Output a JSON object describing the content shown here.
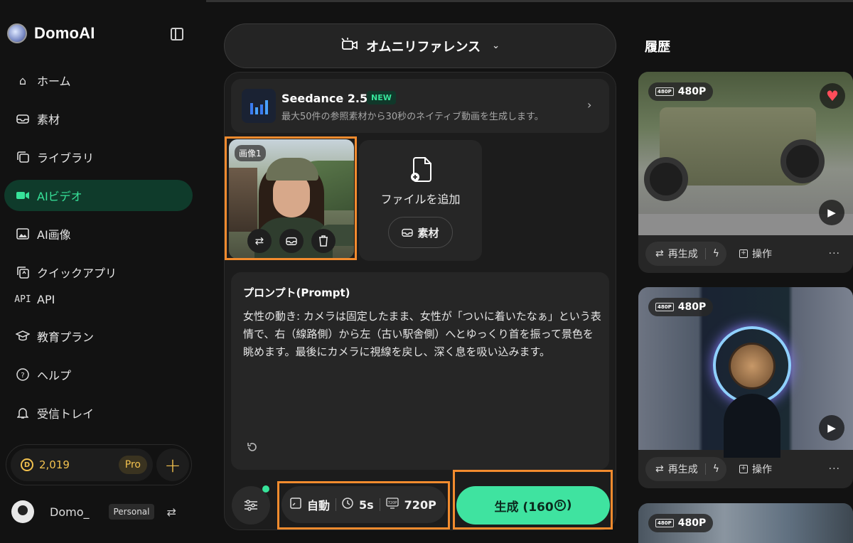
{
  "app": {
    "name": "DomoAI"
  },
  "sidebar": {
    "items": [
      {
        "label": "ホーム",
        "icon": "home-icon",
        "glyph": "⌂"
      },
      {
        "label": "素材",
        "icon": "inbox-icon",
        "glyph": "▭"
      },
      {
        "label": "ライブラリ",
        "icon": "library-icon",
        "glyph": "❐"
      },
      {
        "label": "AIビデオ",
        "icon": "video-camera-icon",
        "glyph": "■"
      },
      {
        "label": "AI画像",
        "icon": "image-icon",
        "glyph": "▣"
      },
      {
        "label": "クイックアプリ",
        "icon": "quick-app-icon",
        "glyph": "⧉"
      },
      {
        "label": "API",
        "icon": "api-icon",
        "glyph": "API"
      },
      {
        "label": "教育プラン",
        "icon": "graduation-cap-icon",
        "glyph": "⌂"
      },
      {
        "label": "ヘルプ",
        "icon": "help-icon",
        "glyph": "?"
      },
      {
        "label": "受信トレイ",
        "icon": "bell-icon",
        "glyph": "♫"
      }
    ],
    "active_index": 3,
    "credits": {
      "amount": "2,019",
      "plan": "Pro",
      "coin_symbol": "D"
    },
    "user": {
      "name": "Domo_",
      "plan_badge": "Personal"
    }
  },
  "main": {
    "mode_label": "オムニリファレンス",
    "model": {
      "name": "Seedance 2.5",
      "badge": "NEW",
      "description": "最大50件の参照素材から30秒のネイティブ動画を生成します。"
    },
    "reference_image": {
      "label": "画像1"
    },
    "add_file": {
      "label": "ファイルを追加",
      "material_button": "素材"
    },
    "prompt": {
      "title": "プロンプト(Prompt)",
      "text": "女性の動き: カメラは固定したまま、女性が「ついに着いたなぁ」という表情で、右（線路側）から左（古い駅舎側）へとゆっくり首を振って景色を眺めます。最後にカメラに視線を戻し、深く息を吸い込みます。"
    },
    "options": {
      "aspect": "自動",
      "duration": "5s",
      "resolution": "720P",
      "resolution_icon_text": "720P"
    },
    "generate_button": "生成 (160",
    "generate_suffix": ")"
  },
  "history": {
    "title": "履歴",
    "items": [
      {
        "resolution": "480P",
        "regen_label": "再生成",
        "op_label": "操作",
        "favorited": true
      },
      {
        "resolution": "480P",
        "regen_label": "再生成",
        "op_label": "操作",
        "favorited": false
      },
      {
        "resolution": "480P"
      }
    ]
  },
  "colors": {
    "accent_green": "#3fe3a0",
    "highlight_orange": "#f28b2e",
    "coin_gold": "#f2c14e"
  }
}
